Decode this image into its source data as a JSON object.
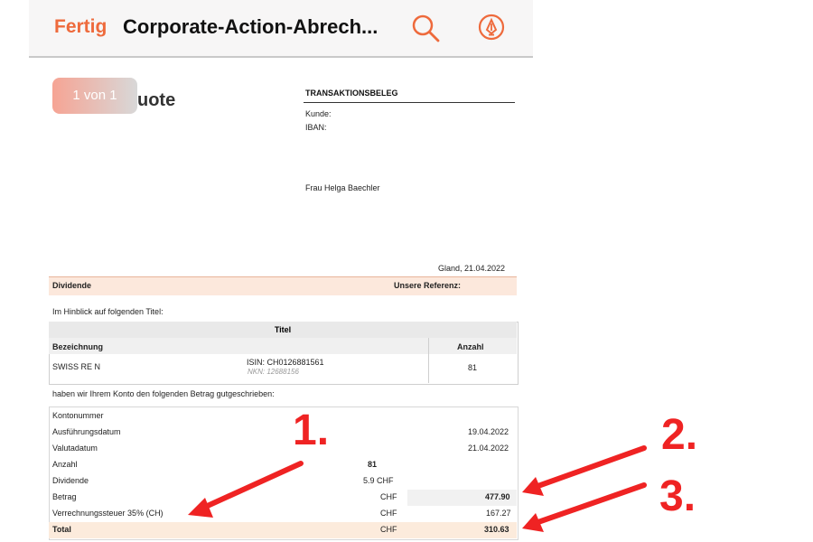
{
  "toolbar": {
    "done": "Fertig",
    "title": "Corporate-Action-Abrech...",
    "search_icon": "search-icon",
    "markup_icon": "markup-icon"
  },
  "document": {
    "page_indicator": "1 von 1",
    "logo_fragment": "uote",
    "header_title": "TRANSAKTIONSBELEG",
    "customer_label": "Kunde:",
    "iban_label": "IBAN:",
    "recipient": "Frau Helga Baechler",
    "place_date": "Gland, 21.04.2022",
    "section_left": "Dividende",
    "section_right_label": "Unsere Referenz:",
    "intro": "Im Hinblick auf folgenden Titel:",
    "table": {
      "title": "Titel",
      "col1": "Bezeichnung",
      "col2": "Anzahl",
      "row": {
        "name": "SWISS RE N",
        "isin": "ISIN: CH0126881561",
        "nkn": "NKN: 12688156",
        "quantity": "81"
      }
    },
    "credit_text": "haben wir Ihrem Konto den folgenden Betrag gutgeschrieben:",
    "details": [
      {
        "label": "Kontonummer",
        "mid": "",
        "value": ""
      },
      {
        "label": "Ausführungsdatum",
        "mid": "",
        "value": "19.04.2022"
      },
      {
        "label": "Valutadatum",
        "mid": "",
        "value": "21.04.2022"
      },
      {
        "label": "Anzahl",
        "mid": "81",
        "value": ""
      },
      {
        "label": "Dividende",
        "mid": "5.9 CHF",
        "value": ""
      },
      {
        "label": "Betrag",
        "mid": "CHF",
        "value": "477.90"
      },
      {
        "label": "Verrechnungssteuer 35% (CH)",
        "mid": "CHF",
        "value": "167.27"
      },
      {
        "label": "Total",
        "mid": "CHF",
        "value": "310.63"
      }
    ],
    "annotations": [
      "1.",
      "2.",
      "3."
    ]
  }
}
